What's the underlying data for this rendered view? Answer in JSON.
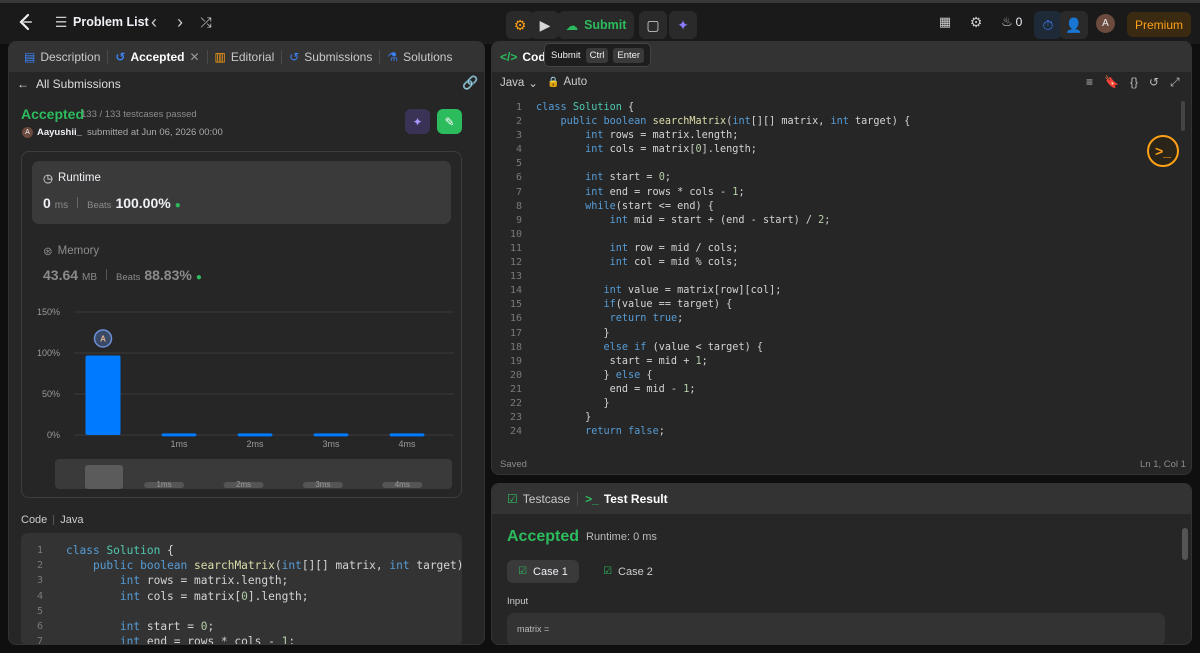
{
  "topbar": {
    "problem_list": "Problem List",
    "submit": "Submit",
    "streak": "0",
    "premium": "Premium",
    "avatar": "A"
  },
  "left": {
    "tabs": [
      "Description",
      "Accepted",
      "Editorial",
      "Submissions",
      "Solutions"
    ],
    "back": "All Submissions",
    "status": "Accepted",
    "testcases": "133 / 133 testcases passed",
    "user": "Aayushii_",
    "user_initial": "A",
    "submitted": "submitted at Jun 06, 2026 00:00",
    "runtime": {
      "label": "Runtime",
      "value": "0",
      "unit": "ms",
      "beats_label": "Beats",
      "beats": "100.00%"
    },
    "memory": {
      "label": "Memory",
      "value": "43.64",
      "unit": "MB",
      "beats_label": "Beats",
      "beats": "88.83%"
    },
    "code_label": "Code",
    "lang": "Java"
  },
  "chart_data": {
    "type": "bar",
    "categories": [
      "",
      "1ms",
      "2ms",
      "3ms",
      "4ms"
    ],
    "values": [
      97,
      2,
      2,
      2,
      2
    ],
    "yticks": [
      "150%",
      "100%",
      "50%",
      "0%"
    ],
    "ylim": [
      0,
      150
    ],
    "marker": "A",
    "accent": "#007aff"
  },
  "editor": {
    "tab": "Code",
    "tooltip": {
      "label": "Submit",
      "k1": "Ctrl",
      "k2": "Enter"
    },
    "lang": "Java",
    "auto": "Auto",
    "saved": "Saved",
    "pos": "Ln 1, Col 1"
  },
  "result": {
    "tab1": "Testcase",
    "tab2": "Test Result",
    "status": "Accepted",
    "runtime": "Runtime: 0 ms",
    "case1": "Case 1",
    "case2": "Case 2",
    "input_label": "Input",
    "input_var": "matrix ="
  },
  "code_lines": [
    "class Solution {",
    "    public boolean searchMatrix(int[][] matrix, int target) {",
    "        int rows = matrix.length;",
    "        int cols = matrix[0].length;",
    "",
    "        int start = 0;",
    "        int end = rows * cols - 1;",
    "        while(start <= end) {",
    "            int mid = start + (end - start) / 2;",
    "",
    "            int row = mid / cols;",
    "            int col = mid % cols;",
    "",
    "           int value = matrix[row][col];",
    "           if(value == target) {",
    "            return true;",
    "           }",
    "           else if (value < target) {",
    "            start = mid + 1;",
    "           } else {",
    "            end = mid - 1;",
    "           }",
    "        }",
    "        return false;"
  ]
}
